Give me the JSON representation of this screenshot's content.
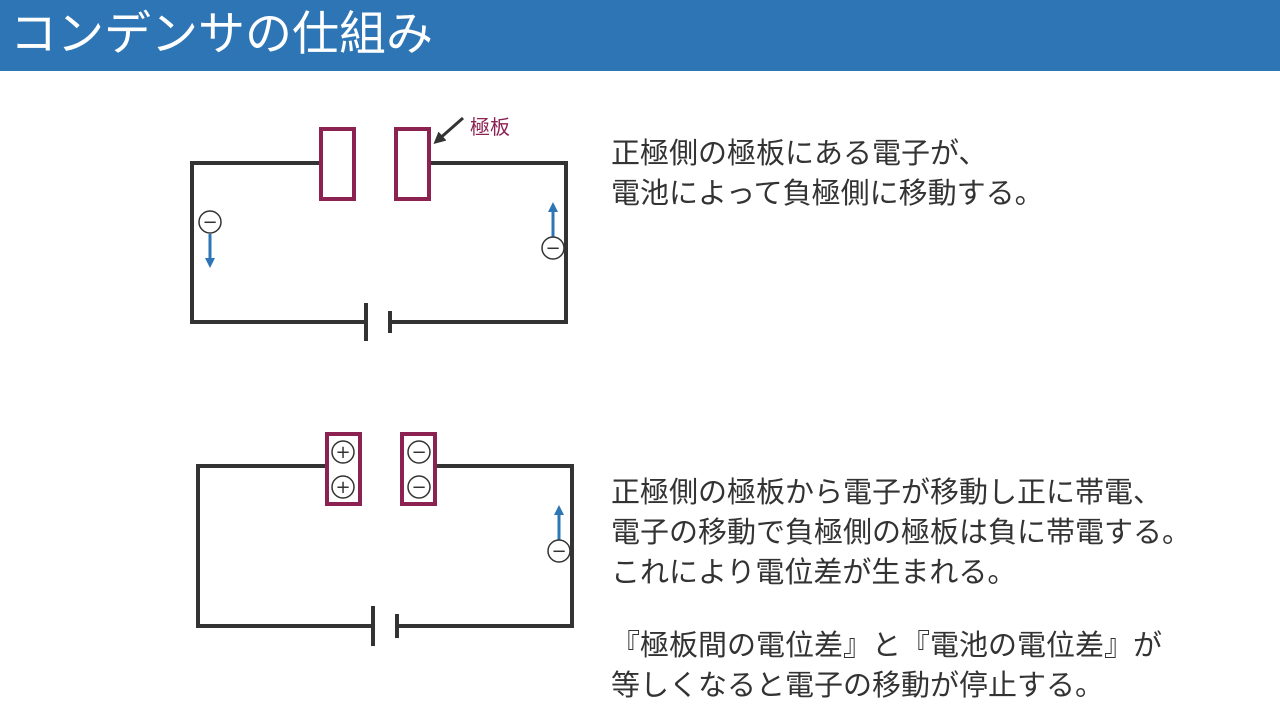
{
  "slide": {
    "title": "コンデンサの仕組み"
  },
  "diagram1": {
    "plate_label": "極板",
    "left_charge": "−",
    "right_charge": "−"
  },
  "diagram2": {
    "left_plate_charges": [
      "+",
      "+"
    ],
    "right_plate_charges": [
      "−",
      "−"
    ],
    "right_wire_charge": "−"
  },
  "text": {
    "step1": [
      "正極側の極板にある電子が、",
      "電池によって負極側に移動する。"
    ],
    "step2": [
      "正極側の極板から電子が移動し正に帯電、",
      "電子の移動で負極側の極板は負に帯電する。",
      "これにより電位差が生まれる。"
    ],
    "step3": [
      "『極板間の電位差』と『電池の電位差』が",
      "等しくなると電子の移動が停止する。"
    ]
  },
  "colors": {
    "title_bg": "#2e75b6",
    "plate": "#8b2252",
    "wire": "#333333",
    "arrow": "#2e75b6"
  }
}
